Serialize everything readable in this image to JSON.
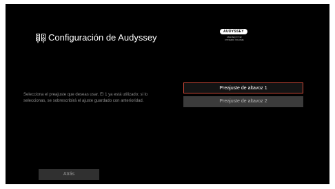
{
  "header": {
    "title": "Configuración de Audyssey",
    "icon": "speaker-pair-icon"
  },
  "logo": {
    "brand": "AUDYSSEY",
    "line1": "MULTEQ XT 32",
    "line2": "DYNAMIC VOLUME"
  },
  "main": {
    "description": "Selecciona el preajuste que deseas usar. El 1 ya está utilizado; si lo seleccionas, se sobrescribirá el ajuste guardado con anterioridad.",
    "presets": [
      {
        "label": "Preajuste de altavoz 1",
        "selected": true
      },
      {
        "label": "Preajuste de altavoz 2",
        "selected": false
      }
    ],
    "back_label": "Atrás"
  },
  "colors": {
    "background": "#000000",
    "selected_border": "#d24a39",
    "button_fill": "#3a3a3a"
  }
}
